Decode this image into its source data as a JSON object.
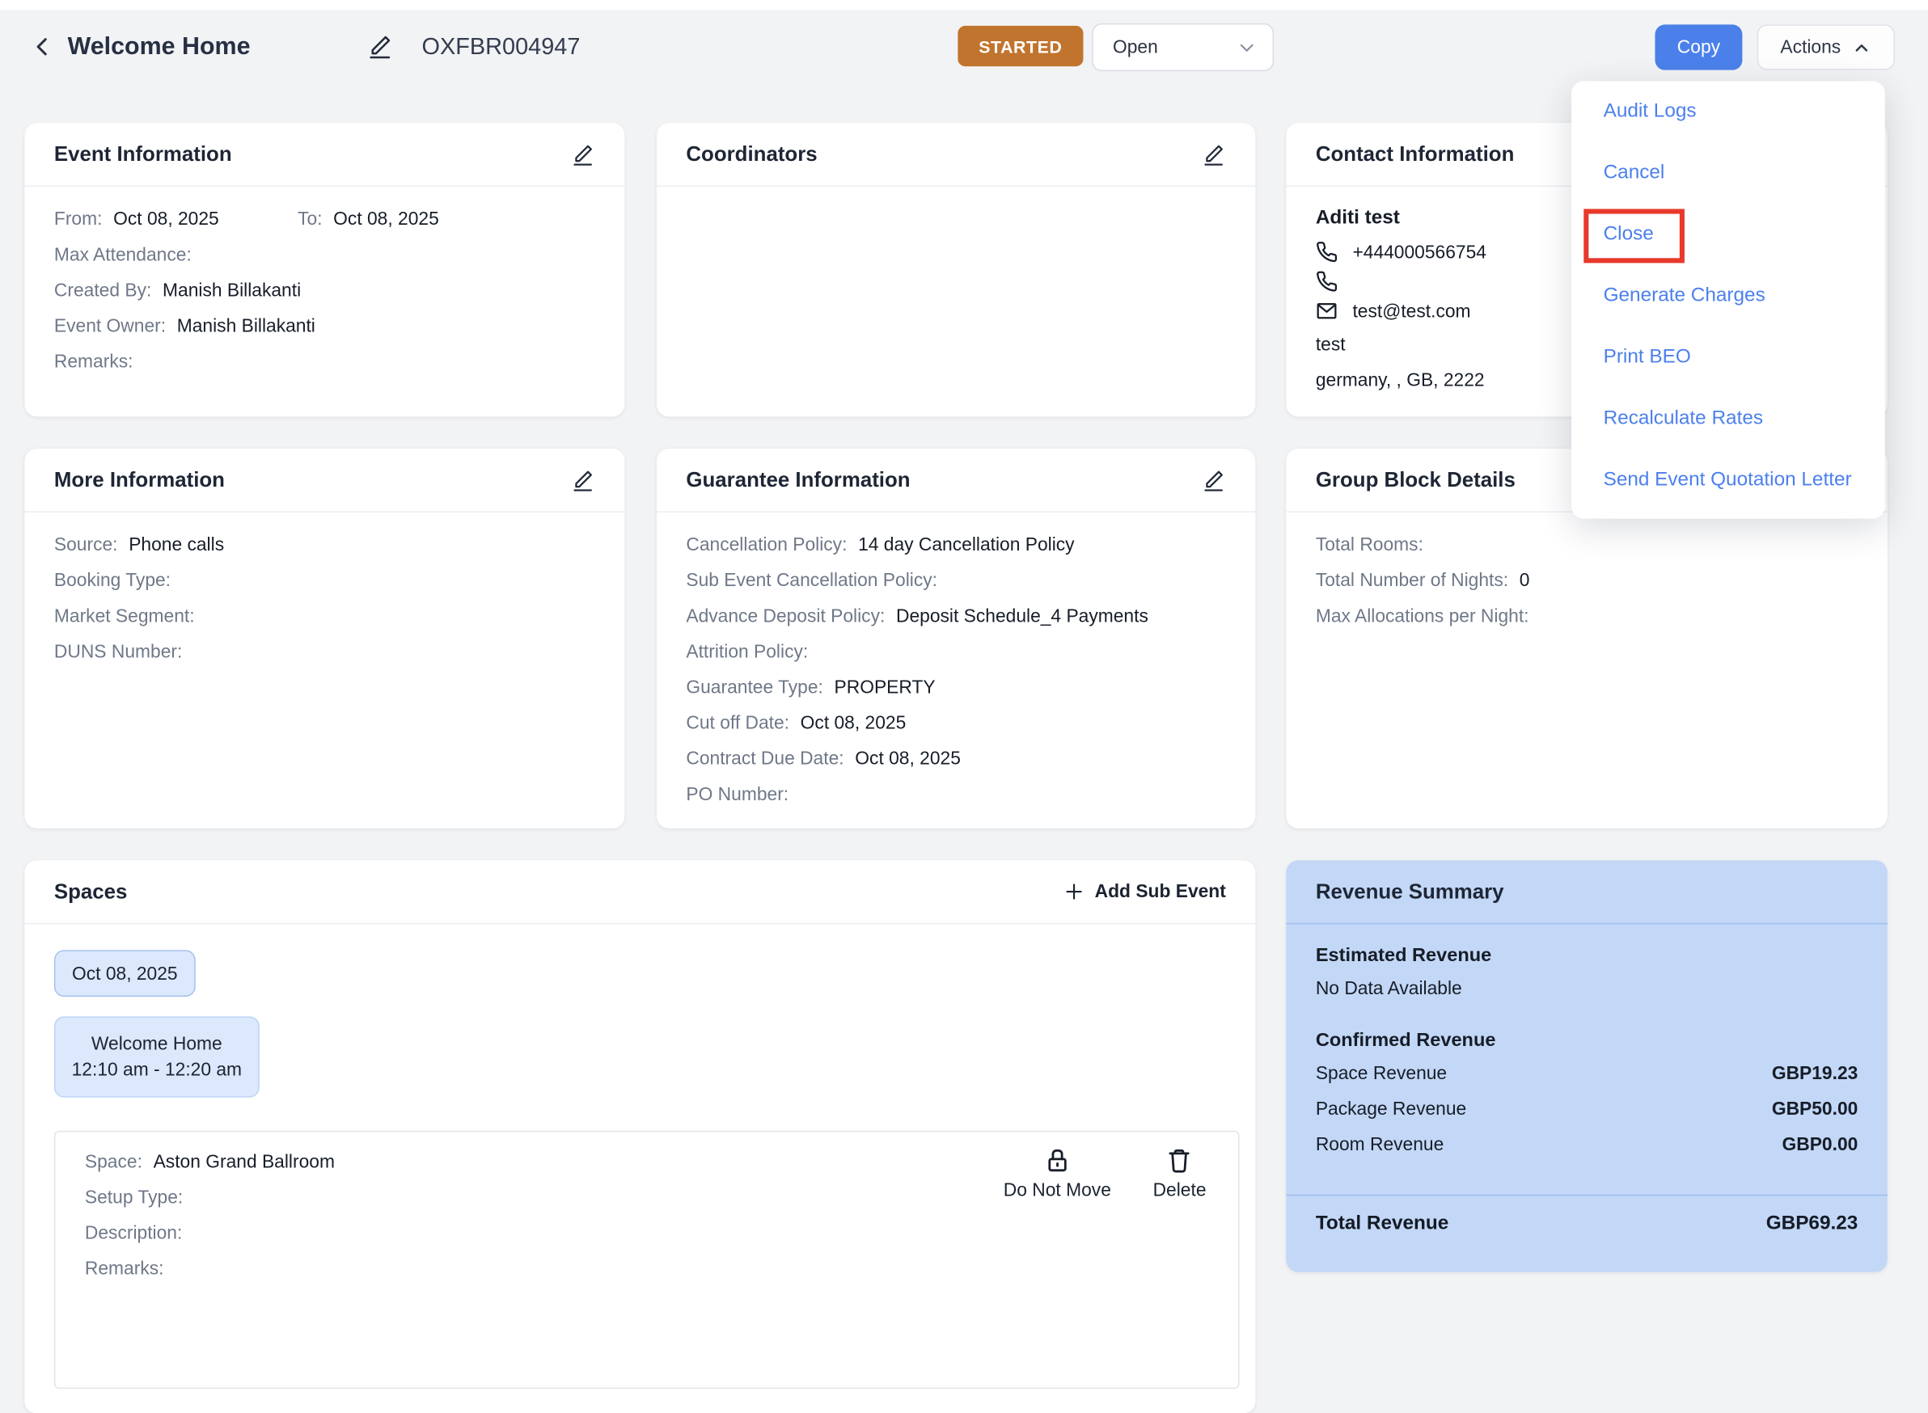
{
  "header": {
    "title": "Welcome Home",
    "code": "OXFBR004947",
    "status_badge": {
      "label": "STARTED",
      "color": "#c1742e"
    },
    "status_select": {
      "value": "Open"
    },
    "copy_button": {
      "label": "Copy",
      "color": "#4b80ea"
    },
    "actions_button": {
      "label": "Actions"
    }
  },
  "actions_menu": {
    "items": [
      "Audit Logs",
      "Cancel",
      "Close",
      "Generate Charges",
      "Print BEO",
      "Recalculate Rates",
      "Send Event Quotation Letter"
    ],
    "annotated_item": "Close",
    "annotation_color": "#e8392b"
  },
  "event_information": {
    "title": "Event Information",
    "from_label": "From:",
    "from_value": "Oct 08, 2025",
    "to_label": "To:",
    "to_value": "Oct 08, 2025",
    "fields": [
      {
        "label": "Max Attendance:",
        "value": ""
      },
      {
        "label": "Created By:",
        "value": "Manish Billakanti"
      },
      {
        "label": "Event Owner:",
        "value": "Manish Billakanti"
      },
      {
        "label": "Remarks:",
        "value": ""
      }
    ]
  },
  "coordinators": {
    "title": "Coordinators"
  },
  "contact_information": {
    "title": "Contact Information",
    "name": "Aditi test",
    "phone1": "+444000566754",
    "phone2": "",
    "email": "test@test.com",
    "address_line1": "test",
    "address_line2": "germany, , GB, 2222"
  },
  "more_information": {
    "title": "More Information",
    "fields": [
      {
        "label": "Source:",
        "value": "Phone calls"
      },
      {
        "label": "Booking Type:",
        "value": ""
      },
      {
        "label": "Market Segment:",
        "value": ""
      },
      {
        "label": "DUNS Number:",
        "value": ""
      }
    ]
  },
  "guarantee_information": {
    "title": "Guarantee Information",
    "fields": [
      {
        "label": "Cancellation Policy:",
        "value": "14 day Cancellation Policy"
      },
      {
        "label": "Sub Event Cancellation Policy:",
        "value": ""
      },
      {
        "label": "Advance Deposit Policy:",
        "value": "Deposit Schedule_4 Payments"
      },
      {
        "label": "Attrition Policy:",
        "value": ""
      },
      {
        "label": "Guarantee Type:",
        "value": "PROPERTY"
      },
      {
        "label": "Cut off Date:",
        "value": "Oct 08, 2025"
      },
      {
        "label": "Contract Due Date:",
        "value": "Oct 08, 2025"
      },
      {
        "label": "PO Number:",
        "value": ""
      }
    ]
  },
  "group_block_details": {
    "title": "Group Block Details",
    "fields": [
      {
        "label": "Total Rooms:",
        "value": ""
      },
      {
        "label": "Total Number of Nights:",
        "value": "0"
      },
      {
        "label": "Max Allocations per Night:",
        "value": ""
      }
    ]
  },
  "spaces": {
    "title": "Spaces",
    "add_button": "Add Sub Event",
    "date_chip": "Oct 08, 2025",
    "event_chip": {
      "line1": "Welcome Home",
      "line2": "12:10 am - 12:20 am"
    },
    "space_row": {
      "fields": [
        {
          "label": "Space:",
          "value": "Aston Grand Ballroom"
        },
        {
          "label": "Setup Type:",
          "value": ""
        },
        {
          "label": "Description:",
          "value": ""
        },
        {
          "label": "Remarks:",
          "value": ""
        }
      ],
      "do_not_move_label": "Do Not Move",
      "delete_label": "Delete"
    }
  },
  "revenue_summary": {
    "title": "Revenue Summary",
    "bg": "#c3d7f6",
    "estimated_heading": "Estimated Revenue",
    "no_data": "No Data Available",
    "confirmed_heading": "Confirmed Revenue",
    "rows": [
      {
        "label": "Space Revenue",
        "value": "GBP19.23"
      },
      {
        "label": "Package Revenue",
        "value": "GBP50.00"
      },
      {
        "label": "Room Revenue",
        "value": "GBP0.00"
      }
    ],
    "total_label": "Total Revenue",
    "total_value": "GBP69.23"
  }
}
